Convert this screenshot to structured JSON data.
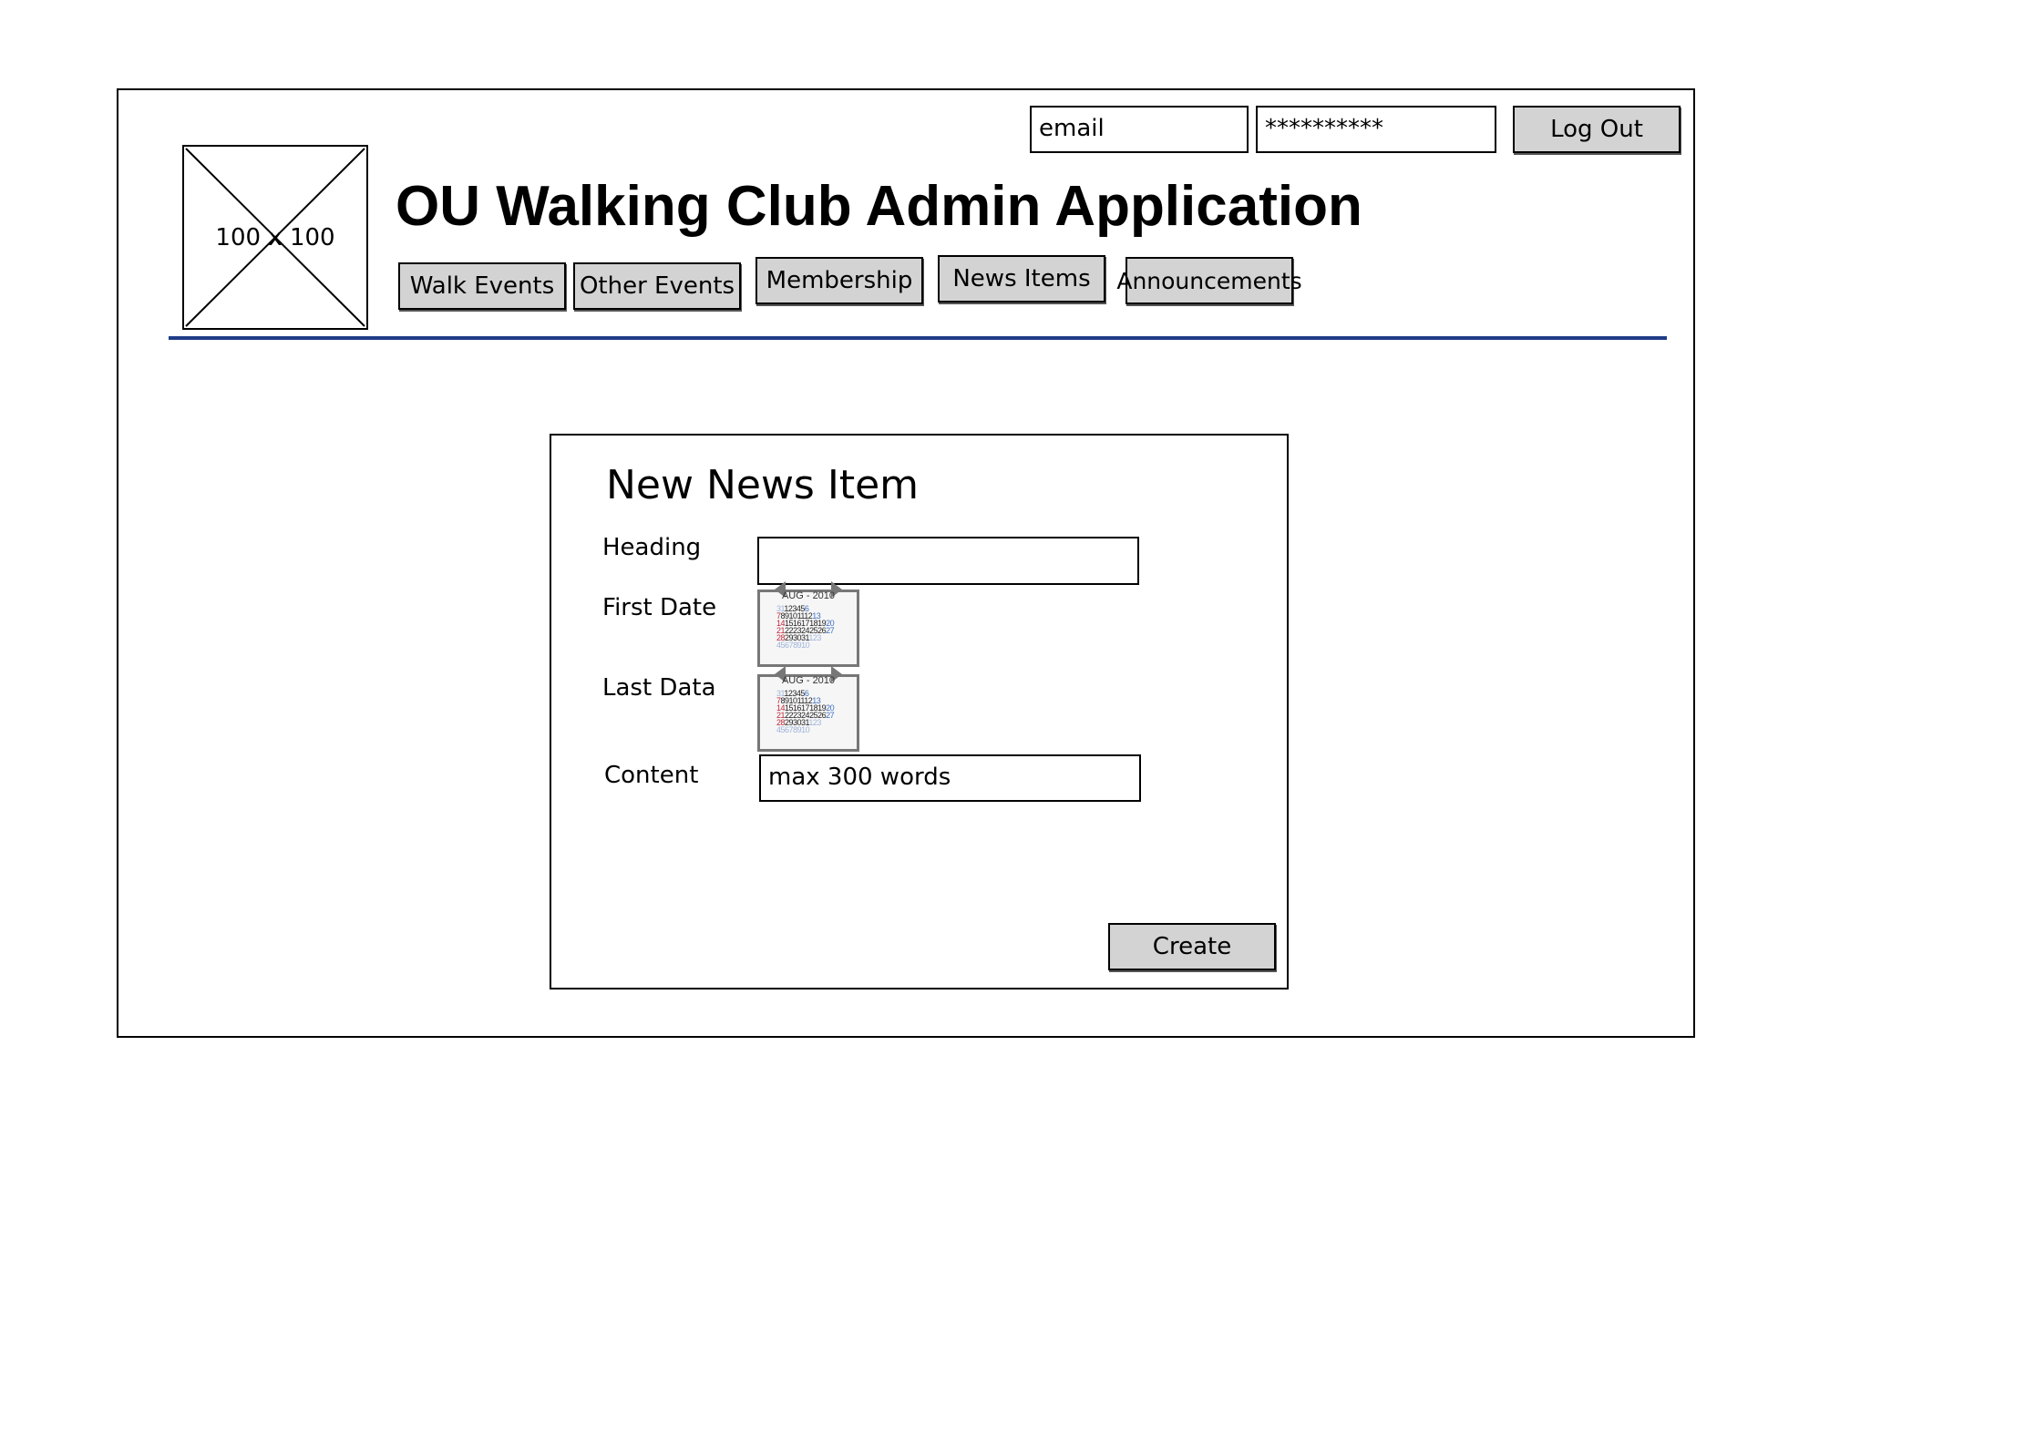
{
  "header": {
    "title": "OU Walking Club Admin Application",
    "logo_placeholder": "100 x 100",
    "email_value": "email",
    "password_value": "**********",
    "logout_label": "Log Out"
  },
  "nav": {
    "items": [
      {
        "label": "Walk Events"
      },
      {
        "label": "Other Events"
      },
      {
        "label": "Membership"
      },
      {
        "label": "News Items"
      },
      {
        "label": "Announcements"
      }
    ]
  },
  "form": {
    "title": "New News Item",
    "heading_label": "Heading",
    "heading_value": "",
    "first_date_label": "First Date",
    "last_date_label": "Last Data",
    "content_label": "Content",
    "content_placeholder": "max 300 words",
    "create_label": "Create"
  },
  "calendar": {
    "month_label": "AUG - 2010",
    "rows": [
      [
        "31",
        "1",
        "2",
        "3",
        "4",
        "5",
        "6"
      ],
      [
        "7",
        "8",
        "9",
        "10",
        "11",
        "12",
        "13"
      ],
      [
        "14",
        "15",
        "16",
        "17",
        "18",
        "19",
        "20"
      ],
      [
        "21",
        "22",
        "23",
        "24",
        "25",
        "26",
        "27"
      ],
      [
        "28",
        "29",
        "30",
        "31",
        "1",
        "2",
        "3"
      ],
      [
        "4",
        "5",
        "6",
        "7",
        "8",
        "9",
        "10"
      ]
    ]
  },
  "colors": {
    "divider": "#1f3c88",
    "button_fill": "#d3d3d3",
    "weekend": "#c0283a",
    "saturday": "#3f6fc2"
  }
}
